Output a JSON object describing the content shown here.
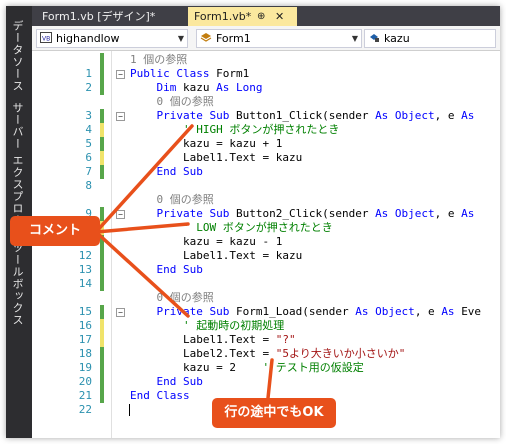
{
  "sidebar": {
    "labels": [
      "データソース",
      "サーバー エクスプローラー",
      "ツールボックス"
    ]
  },
  "tabs": [
    {
      "label": "Form1.vb [デザイン]*",
      "active": false
    },
    {
      "label": "Form1.vb*",
      "active": true,
      "pin": "⊕",
      "close": "✕"
    }
  ],
  "navbar": {
    "project_dropdown": "highandlow",
    "class_dropdown": "Form1",
    "member_dropdown": "kazu"
  },
  "code_lines": [
    {
      "ln": "",
      "chg": "green",
      "tokens": [
        [
          "ref",
          "1 個の参照"
        ]
      ]
    },
    {
      "ln": "1",
      "chg": "green",
      "fold": "−",
      "tokens": [
        [
          "kw",
          "Public Class "
        ],
        [
          "",
          "Form1"
        ]
      ]
    },
    {
      "ln": "2",
      "chg": "green",
      "tokens": [
        [
          "",
          "    "
        ],
        [
          "kw",
          "Dim "
        ],
        [
          "",
          "kazu "
        ],
        [
          "kw",
          "As Long"
        ]
      ]
    },
    {
      "ln": "",
      "chg": "",
      "tokens": [
        [
          "ref",
          "    0 個の参照"
        ]
      ]
    },
    {
      "ln": "3",
      "chg": "green",
      "fold": "−",
      "tokens": [
        [
          "",
          "    "
        ],
        [
          "kw",
          "Private Sub "
        ],
        [
          "",
          "Button1_Click(sender "
        ],
        [
          "kw",
          "As Object"
        ],
        [
          "",
          ", e "
        ],
        [
          "kw",
          "As"
        ]
      ]
    },
    {
      "ln": "4",
      "chg": "yellow",
      "tokens": [
        [
          "",
          "        "
        ],
        [
          "cm",
          "' HIGH ボタンが押されたとき"
        ]
      ]
    },
    {
      "ln": "5",
      "chg": "green",
      "tokens": [
        [
          "",
          "        kazu = kazu + 1"
        ]
      ]
    },
    {
      "ln": "6",
      "chg": "yellow",
      "tokens": [
        [
          "",
          "        Label1.Text = kazu"
        ]
      ]
    },
    {
      "ln": "7",
      "chg": "green",
      "tokens": [
        [
          "",
          "    "
        ],
        [
          "kw",
          "End Sub"
        ]
      ]
    },
    {
      "ln": "8",
      "chg": "",
      "tokens": []
    },
    {
      "ln": "",
      "chg": "",
      "tokens": [
        [
          "ref",
          "    0 個の参照"
        ]
      ]
    },
    {
      "ln": "9",
      "chg": "green",
      "fold": "−",
      "tokens": [
        [
          "",
          "    "
        ],
        [
          "kw",
          "Private Sub "
        ],
        [
          "",
          "Button2_Click(sender "
        ],
        [
          "kw",
          "As Object"
        ],
        [
          "",
          ", e "
        ],
        [
          "kw",
          "As"
        ]
      ]
    },
    {
      "ln": "10",
      "chg": "yellow",
      "tokens": [
        [
          "",
          "        "
        ],
        [
          "cm",
          "' LOW ボタンが押されたとき"
        ]
      ]
    },
    {
      "ln": "11",
      "chg": "green",
      "tokens": [
        [
          "",
          "        kazu = kazu - 1"
        ]
      ]
    },
    {
      "ln": "12",
      "chg": "green",
      "tokens": [
        [
          "",
          "        Label1.Text = kazu"
        ]
      ]
    },
    {
      "ln": "13",
      "chg": "green",
      "tokens": [
        [
          "",
          "    "
        ],
        [
          "kw",
          "End Sub"
        ]
      ]
    },
    {
      "ln": "14",
      "chg": "green",
      "tokens": []
    },
    {
      "ln": "",
      "chg": "",
      "tokens": [
        [
          "ref",
          "    0 個の参照"
        ]
      ]
    },
    {
      "ln": "15",
      "chg": "green",
      "fold": "−",
      "tokens": [
        [
          "",
          "    "
        ],
        [
          "kw",
          "Private Sub "
        ],
        [
          "",
          "Form1_Load(sender "
        ],
        [
          "kw",
          "As Object"
        ],
        [
          "",
          ", e "
        ],
        [
          "kw",
          "As "
        ],
        [
          "",
          "Eve"
        ]
      ]
    },
    {
      "ln": "16",
      "chg": "yellow",
      "tokens": [
        [
          "",
          "        "
        ],
        [
          "cm",
          "' 起動時の初期処理"
        ]
      ]
    },
    {
      "ln": "17",
      "chg": "yellow",
      "tokens": [
        [
          "",
          "        Label1.Text = "
        ],
        [
          "st",
          "\"?\""
        ]
      ]
    },
    {
      "ln": "18",
      "chg": "green",
      "tokens": [
        [
          "",
          "        Label2.Text = "
        ],
        [
          "st",
          "\"5より大きいか小さいか\""
        ]
      ]
    },
    {
      "ln": "19",
      "chg": "green",
      "tokens": [
        [
          "",
          "        kazu = 2    "
        ],
        [
          "cm",
          "' テスト用の仮設定"
        ]
      ]
    },
    {
      "ln": "20",
      "chg": "green",
      "tokens": [
        [
          "",
          "    "
        ],
        [
          "kw",
          "End Sub"
        ]
      ]
    },
    {
      "ln": "21",
      "chg": "green",
      "tokens": [
        [
          "kw",
          "End Class"
        ]
      ]
    },
    {
      "ln": "22",
      "chg": "",
      "tokens": []
    }
  ],
  "annotations": {
    "comment_label": "コメント",
    "midline_label": "行の途中でもOK",
    "accent_color": "#e8501b"
  },
  "colors": {
    "change_green": "#57a64a",
    "change_yellow": "#f0e36a",
    "keyword": "#0000ff",
    "comment": "#008000",
    "string": "#a31515"
  }
}
